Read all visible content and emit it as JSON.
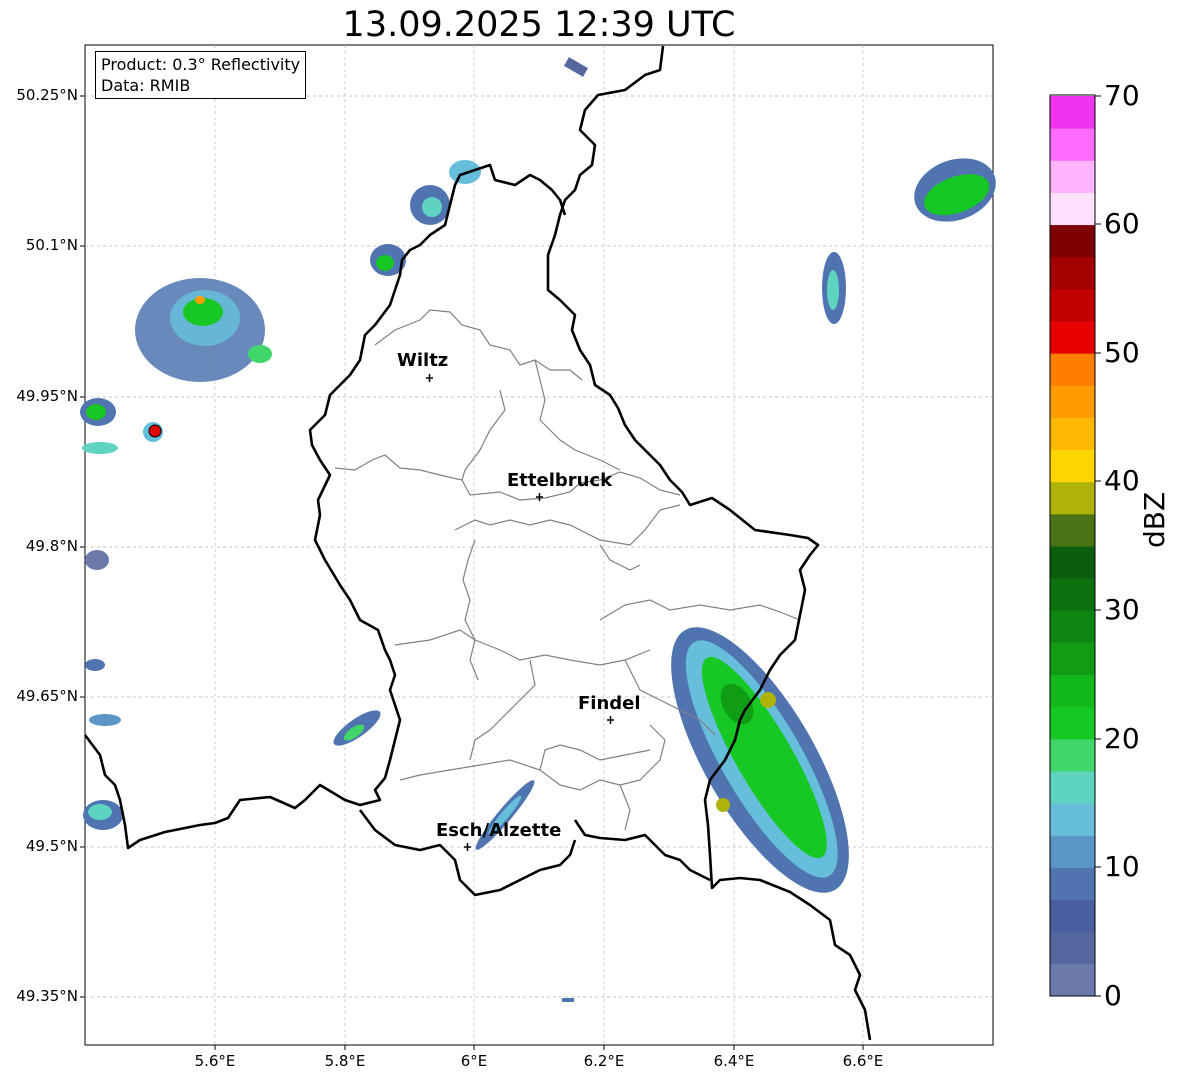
{
  "title": "13.09.2025 12:39 UTC",
  "info": {
    "product": "Product: 0.3° Reflectivity",
    "data": "Data: RMIB"
  },
  "lat_labels": [
    "50.25°N",
    "50.1°N",
    "49.95°N",
    "49.8°N",
    "49.65°N",
    "49.5°N",
    "49.35°N"
  ],
  "lon_labels": [
    "5.6°E",
    "5.8°E",
    "6°E",
    "6.2°E",
    "6.4°E",
    "6.6°E"
  ],
  "cities": [
    {
      "name": "Wiltz"
    },
    {
      "name": "Ettelbruck"
    },
    {
      "name": "Findel"
    },
    {
      "name": "Esch/Alzette"
    }
  ],
  "colorbar": {
    "label": "dBZ",
    "ticks": [
      "0",
      "10",
      "20",
      "30",
      "40",
      "50",
      "60",
      "70"
    ],
    "colors": [
      "#6b7aab",
      "#56679f",
      "#4a5fa0",
      "#4f74b0",
      "#5b97c6",
      "#66bedb",
      "#5ed4c0",
      "#40d66a",
      "#15c823",
      "#13b81a",
      "#109c14",
      "#0e8712",
      "#0c7210",
      "#0b5e0e",
      "#4b7314",
      "#aeb209",
      "#ffd500",
      "#ffb800",
      "#ff9c00",
      "#ff7e00",
      "#e60000",
      "#c10000",
      "#a30000",
      "#7f0000",
      "#ffe1ff",
      "#ffb4ff",
      "#ff6cff",
      "#ef33ef"
    ]
  }
}
